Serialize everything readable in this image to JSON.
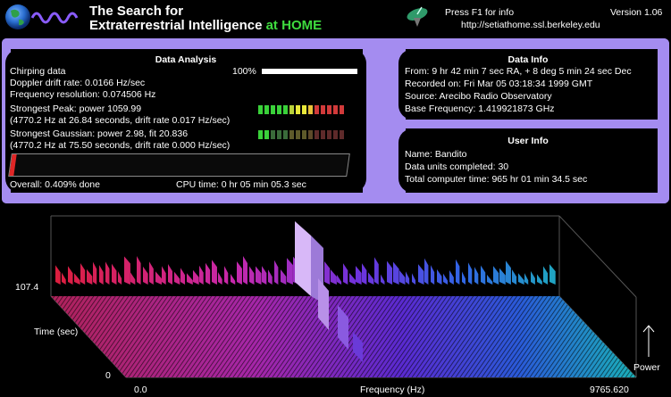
{
  "header": {
    "title_line1": "The Search for",
    "title_line2": "Extraterrestrial Intelligence",
    "title_at": "at",
    "title_home": "HOME",
    "press_f1": "Press F1 for info",
    "version": "Version 1.06",
    "url": "http://setiathome.ssl.berkeley.edu"
  },
  "analysis": {
    "title": "Data Analysis",
    "chirping": "Chirping data",
    "chirp_pct": "100%",
    "chirp_fraction": 1.0,
    "doppler": "Doppler drift rate: 0.0166 Hz/sec",
    "resolution": "Frequency resolution: 0.074506 Hz",
    "peak": "Strongest Peak: power 1059.99",
    "peak_detail": "(4770.2 Hz at 26.84 seconds, drift rate 0.017 Hz/sec)",
    "gaussian": "Strongest Gaussian: power  2.98, fit 20.836",
    "gaussian_detail": "(4770.2 Hz at 75.50 seconds, drift rate 0.000 Hz/sec)",
    "overall": "Overall:  0.409% done",
    "overall_fraction": 0.00409,
    "cpu": "CPU time: 0 hr 05 min 05.3 sec",
    "peak_meter": [
      "#3ad13a",
      "#3ad13a",
      "#3ad13a",
      "#3ad13a",
      "#3ad13a",
      "#b9d13a",
      "#e8e83a",
      "#e8e83a",
      "#e8c23a",
      "#d13a3a",
      "#d13a3a",
      "#d13a3a",
      "#d13a3a",
      "#d13a3a"
    ],
    "gauss_meter": [
      "#3ad13a",
      "#3ad13a",
      "#3a6b3a",
      "#3a6b3a",
      "#3a6b3a",
      "#5e5a2a",
      "#5e5a2a",
      "#5e5a2a",
      "#5e4a2a",
      "#5e2a2a",
      "#5e2a2a",
      "#5e2a2a",
      "#5e2a2a",
      "#5e2a2a"
    ]
  },
  "datainfo": {
    "title": "Data Info",
    "from": "From:  9 hr 42 min  7 sec RA, +  8 deg  5 min 24 sec Dec",
    "recorded": "Recorded on: Fri Mar 05 03:18:34 1999 GMT",
    "source": "Source: Arecibo Radio Observatory",
    "base": "Base Frequency: 1.419921873 GHz"
  },
  "userinfo": {
    "title": "User Info",
    "name": "Name: Bandito",
    "units": "Data units completed: 30",
    "total": "Total computer time: 965 hr 01 min 34.5 sec"
  },
  "graph": {
    "y_top": "107.4",
    "y_bottom": "0",
    "y_label": "Time (sec)",
    "x_left": "0.0",
    "x_right": "9765.620",
    "x_label": "Frequency (Hz)",
    "power_label": "Power"
  },
  "colors": {
    "accent_purple": "#a48cf0",
    "home_green": "#3fdc3f"
  }
}
